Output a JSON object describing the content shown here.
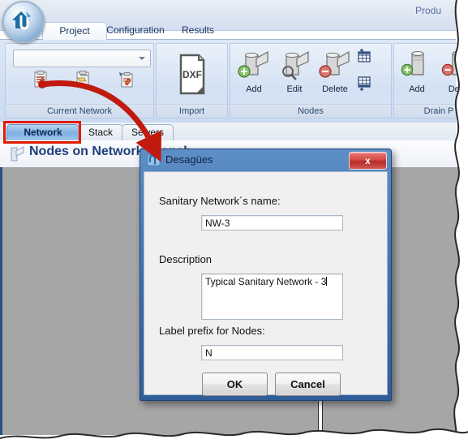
{
  "app": {
    "product_label": "Produ",
    "app_button_icon": "house-pipe-logo-icon"
  },
  "ribbon": {
    "tabs": [
      {
        "label": "Project",
        "active": true
      },
      {
        "label": "Configuration",
        "active": false
      },
      {
        "label": "Results",
        "active": false
      }
    ],
    "groups": [
      {
        "label": "Current Network",
        "combo_value": "",
        "buttons": [
          {
            "label": "",
            "icon": "clipboard-new-icon"
          },
          {
            "label": "",
            "icon": "clipboard-open-icon"
          },
          {
            "label": "",
            "icon": "clipboard-refresh-icon"
          }
        ]
      },
      {
        "label": "Import",
        "buttons": [
          {
            "label": "",
            "icon": "dxf-file-icon"
          }
        ]
      },
      {
        "label": "Nodes",
        "buttons": [
          {
            "label": "Add",
            "icon": "pipe-junction-add-icon"
          },
          {
            "label": "Edit",
            "icon": "pipe-junction-edit-icon"
          },
          {
            "label": "Delete",
            "icon": "pipe-junction-delete-icon"
          },
          {
            "label": "",
            "icon": "table-add-row-top-icon"
          },
          {
            "label": "",
            "icon": "table-add-row-bottom-icon"
          }
        ]
      },
      {
        "label": "Drain P",
        "buttons": [
          {
            "label": "Add",
            "icon": "pipe-add-icon"
          },
          {
            "label": "Dele",
            "icon": "pipe-delete-icon"
          }
        ]
      }
    ]
  },
  "inner_tabs": [
    {
      "label": "Network",
      "active": true
    },
    {
      "label": "Stack",
      "active": false
    },
    {
      "label": "Sewers",
      "active": false
    }
  ],
  "page": {
    "title": "Nodes on Network Branch",
    "icon": "branch-node-icon"
  },
  "dialog": {
    "title": "Desagües",
    "icon": "network-window-icon",
    "close_label": "x",
    "fields": [
      {
        "label": "Sanitary Network´s name:",
        "value": "NW-3"
      },
      {
        "label": "Description",
        "value": "Typical Sanitary Network - 3"
      },
      {
        "label": "Label prefix for Nodes:",
        "value": "N"
      }
    ],
    "buttons": {
      "ok": "OK",
      "cancel": "Cancel"
    }
  },
  "annotations": {
    "highlight_color": "#e01b00",
    "arrow_color": "#c11a0f",
    "highlight_target": "Network"
  }
}
